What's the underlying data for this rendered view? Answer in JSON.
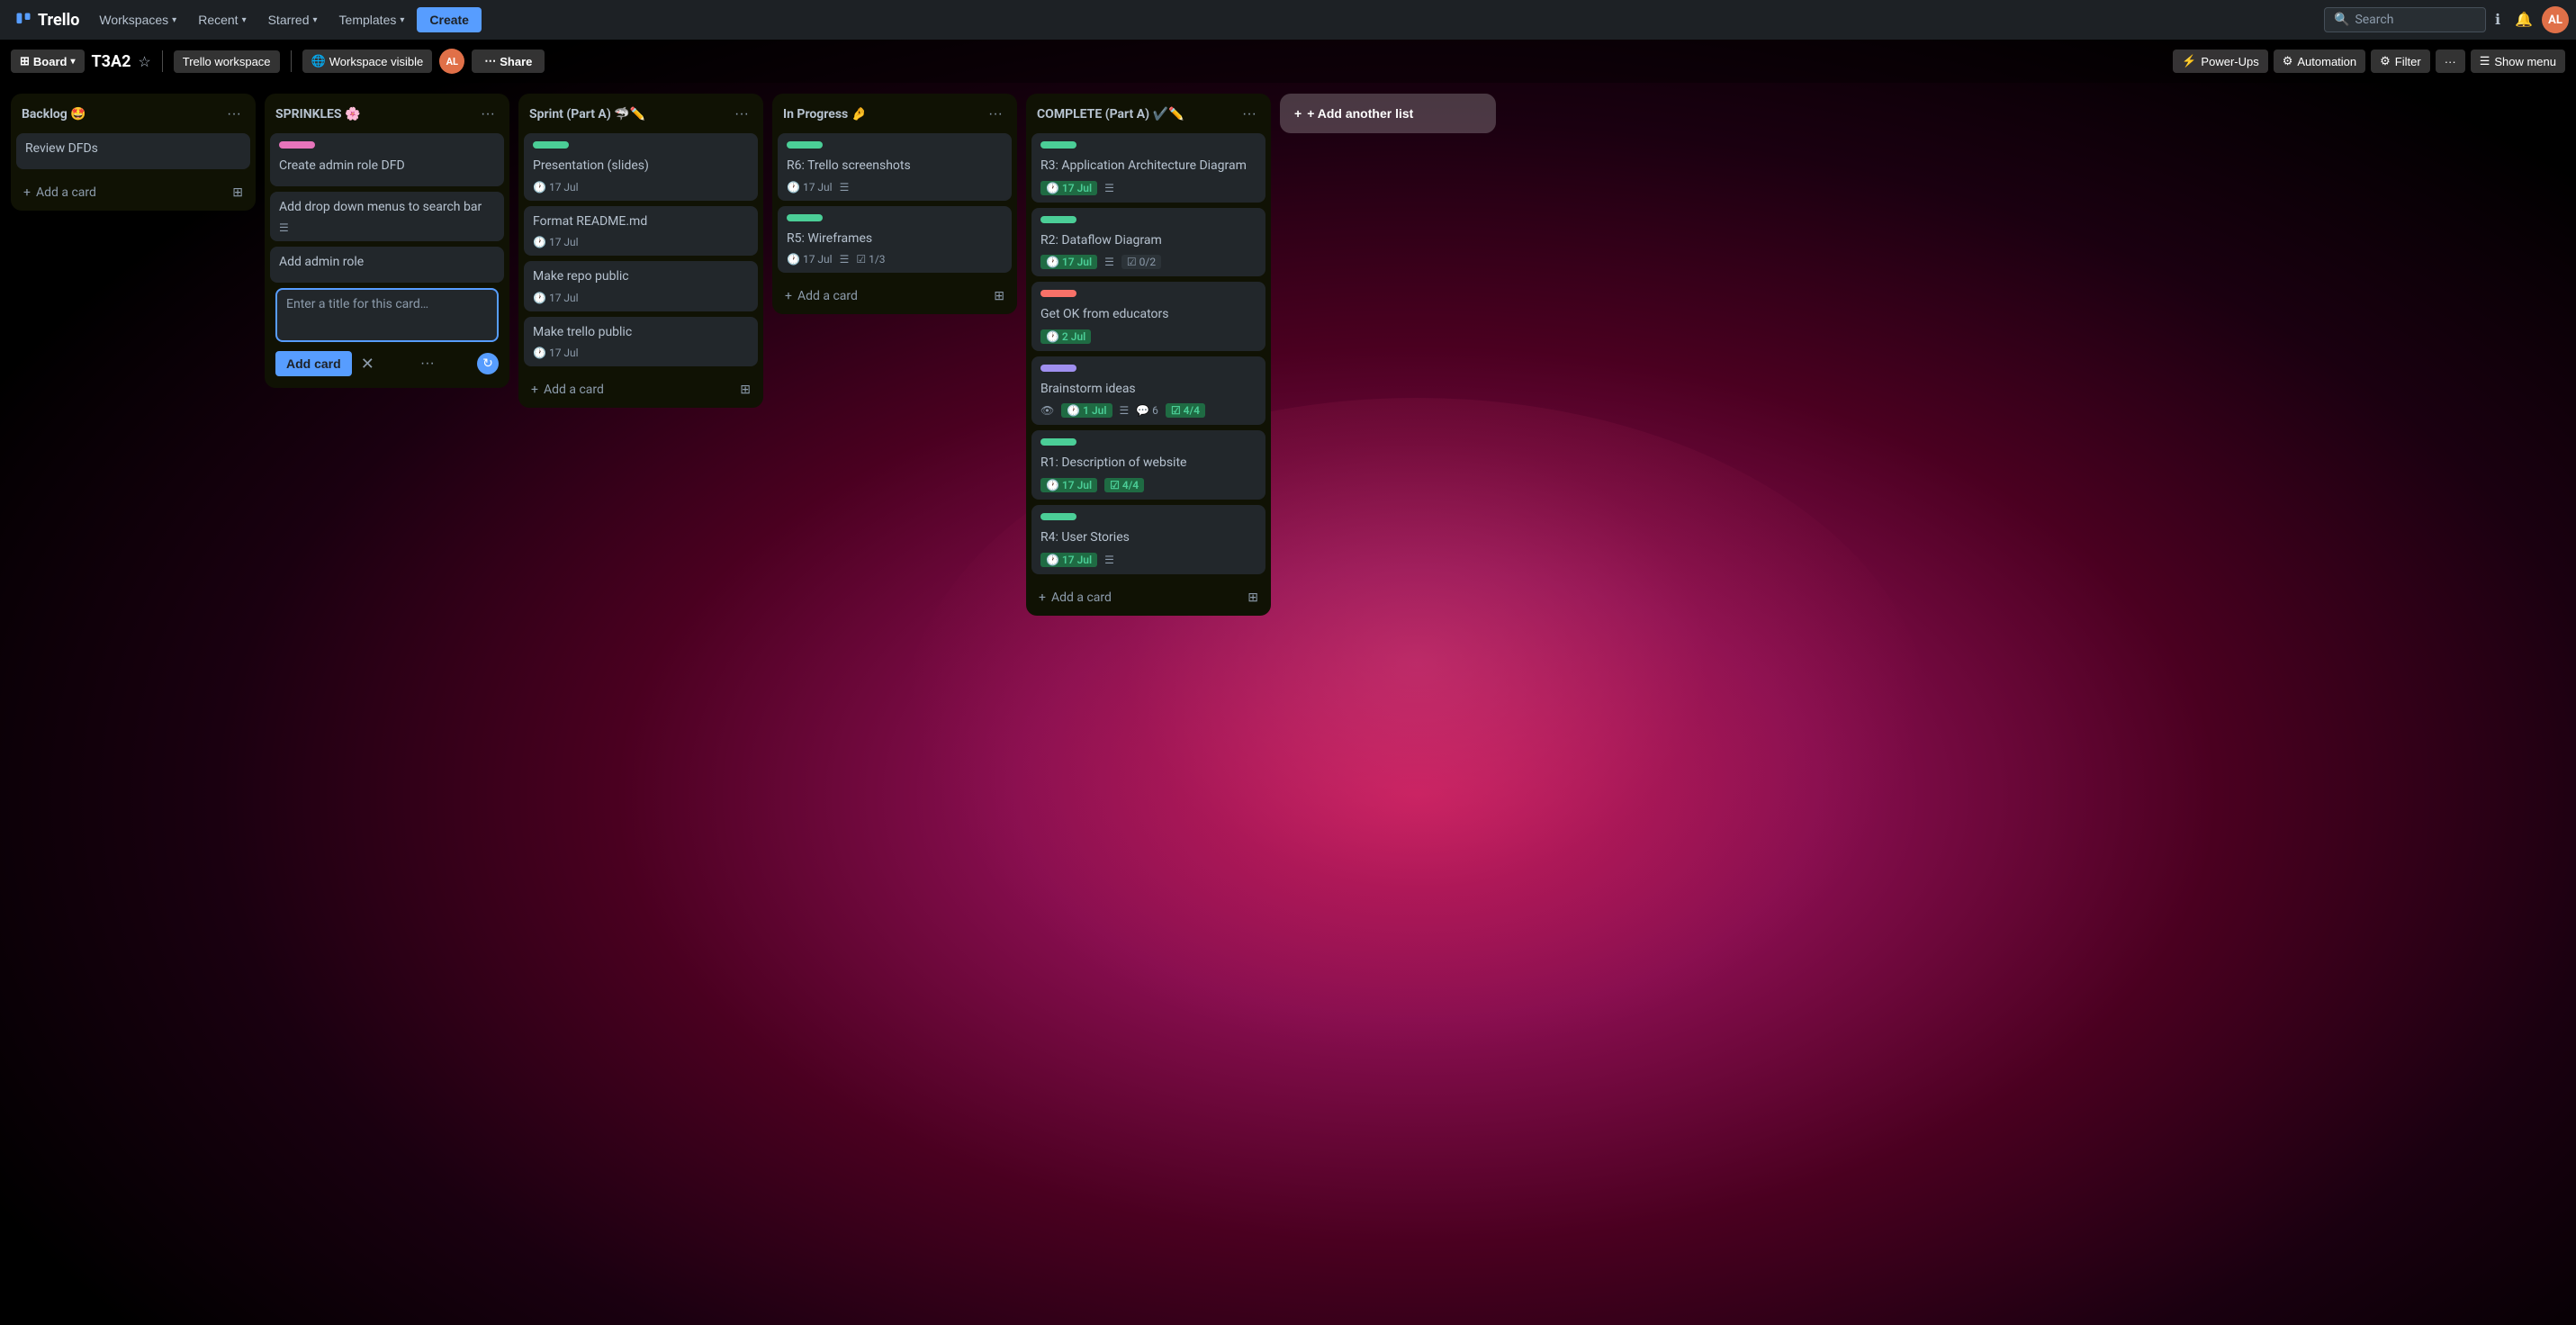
{
  "topnav": {
    "logo": "Trello",
    "workspaces_label": "Workspaces",
    "recent_label": "Recent",
    "starred_label": "Starred",
    "templates_label": "Templates",
    "create_label": "Create",
    "search_placeholder": "Search",
    "notifications_icon": "bell-icon",
    "info_icon": "info-icon",
    "avatar_initials": "AL"
  },
  "board_header": {
    "board_label": "Board",
    "title": "T3A2",
    "star_icon": "star-icon",
    "workspace_label": "Trello workspace",
    "visibility_icon": "globe-icon",
    "visibility_label": "Workspace visible",
    "member_initials": "AL",
    "share_label": "Share",
    "power_ups_label": "Power-Ups",
    "automation_label": "Automation",
    "filter_label": "Filter",
    "more_icon": "dots-icon",
    "show_menu_label": "Show menu"
  },
  "lists": [
    {
      "id": "backlog",
      "title": "Backlog 🤩",
      "cards": [
        {
          "id": "b1",
          "title": "Review DFDs",
          "labels": [],
          "meta": []
        }
      ],
      "add_card_label": "+ Add a card"
    },
    {
      "id": "sprinkles",
      "title": "SPRINKLES 🌸",
      "cards": [
        {
          "id": "s1",
          "title": "Create admin role DFD",
          "labels": [
            {
              "color": "pink"
            }
          ],
          "meta": []
        },
        {
          "id": "s2",
          "title": "Add drop down menus to search bar",
          "labels": [],
          "meta": [],
          "has_desc": true
        },
        {
          "id": "s3",
          "title": "Add admin role",
          "labels": [],
          "meta": []
        }
      ],
      "adding_card": true,
      "add_card_placeholder": "Enter a title for this card…",
      "add_card_label": "Add card",
      "cancel_label": "✕"
    },
    {
      "id": "sprint-a",
      "title": "Sprint (Part A) 🦈✏️",
      "cards": [
        {
          "id": "sa1",
          "title": "Presentation (slides)",
          "labels": [
            {
              "color": "green"
            }
          ],
          "meta": [
            {
              "type": "date",
              "value": "17 Jul"
            }
          ]
        },
        {
          "id": "sa2",
          "title": "Format README.md",
          "labels": [],
          "meta": [
            {
              "type": "date",
              "value": "17 Jul"
            }
          ]
        },
        {
          "id": "sa3",
          "title": "Make repo public",
          "labels": [],
          "meta": [
            {
              "type": "date",
              "value": "17 Jul"
            }
          ]
        },
        {
          "id": "sa4",
          "title": "Make trello public",
          "labels": [],
          "meta": [
            {
              "type": "date",
              "value": "17 Jul"
            }
          ]
        }
      ],
      "add_card_label": "+ Add a card"
    },
    {
      "id": "in-progress",
      "title": "In Progress 🤌",
      "cards": [
        {
          "id": "ip1",
          "title": "R6: Trello screenshots",
          "labels": [
            {
              "color": "green"
            }
          ],
          "meta": [
            {
              "type": "date",
              "value": "17 Jul"
            },
            {
              "type": "desc"
            }
          ]
        },
        {
          "id": "ip2",
          "title": "R5: Wireframes",
          "labels": [
            {
              "color": "green"
            }
          ],
          "meta": [
            {
              "type": "date",
              "value": "17 Jul"
            },
            {
              "type": "desc"
            },
            {
              "type": "checklist",
              "value": "1/3"
            }
          ]
        }
      ],
      "add_card_label": "+ Add a card"
    },
    {
      "id": "complete",
      "title": "COMPLETE (Part A) ✔️✏️",
      "cards": [
        {
          "id": "c1",
          "title": "R3: Application Architecture Diagram",
          "labels": [
            {
              "color": "green"
            }
          ],
          "meta": [
            {
              "type": "date_badge",
              "value": "17 Jul"
            },
            {
              "type": "desc"
            }
          ]
        },
        {
          "id": "c2",
          "title": "R2: Dataflow Diagram",
          "labels": [
            {
              "color": "green"
            }
          ],
          "meta": [
            {
              "type": "date_badge",
              "value": "17 Jul"
            },
            {
              "type": "desc"
            },
            {
              "type": "checklist_badge",
              "value": "0/2"
            }
          ]
        },
        {
          "id": "c3",
          "title": "Get OK from educators",
          "labels": [
            {
              "color": "red"
            }
          ],
          "meta": [
            {
              "type": "date_badge",
              "value": "2 Jul"
            }
          ]
        },
        {
          "id": "c4",
          "title": "Brainstorm ideas",
          "labels": [
            {
              "color": "purple"
            }
          ],
          "meta": [
            {
              "type": "watch"
            },
            {
              "type": "date_badge",
              "value": "1 Jul"
            },
            {
              "type": "desc"
            },
            {
              "type": "comments",
              "value": "6"
            },
            {
              "type": "checklist_done",
              "value": "4/4"
            }
          ]
        },
        {
          "id": "c5",
          "title": "R1: Description of website",
          "labels": [
            {
              "color": "green"
            }
          ],
          "meta": [
            {
              "type": "date_badge",
              "value": "17 Jul"
            },
            {
              "type": "checklist_done",
              "value": "4/4"
            }
          ]
        },
        {
          "id": "c6",
          "title": "R4: User Stories",
          "labels": [
            {
              "color": "green"
            }
          ],
          "meta": [
            {
              "type": "date_badge",
              "value": "17 Jul"
            },
            {
              "type": "desc"
            }
          ]
        }
      ],
      "add_card_label": "+ Add a card"
    }
  ],
  "add_another_list_label": "+ Add another list"
}
